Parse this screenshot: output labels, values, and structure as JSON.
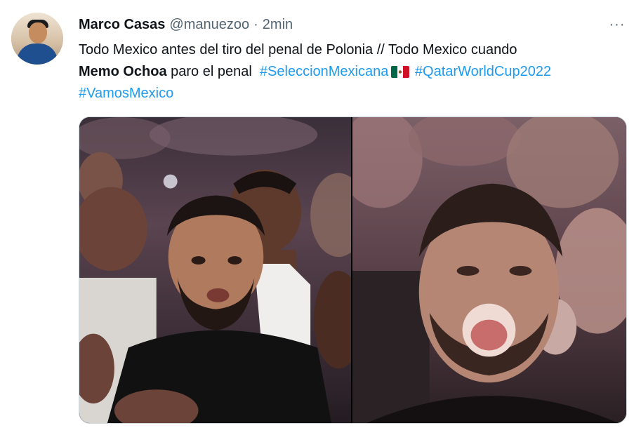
{
  "tweet": {
    "author": {
      "display_name": "Marco Casas",
      "handle": "@manuezoo",
      "separator": "·",
      "time": "2min"
    },
    "more_label": "···",
    "text": {
      "part1": "Todo Mexico antes del tiro del penal de Polonia // Todo Mexico cuando",
      "bold": "Memo Ochoa",
      "part2": "paro el penal",
      "hashtags": [
        "#SeleccionMexicana",
        "#QatarWorldCup2022",
        "#VamosMexico"
      ],
      "flag_icon": "mexico-flag-icon"
    },
    "colors": {
      "link": "#1d9bf0",
      "secondary_text": "#536471",
      "primary_text": "#0f1419"
    }
  }
}
